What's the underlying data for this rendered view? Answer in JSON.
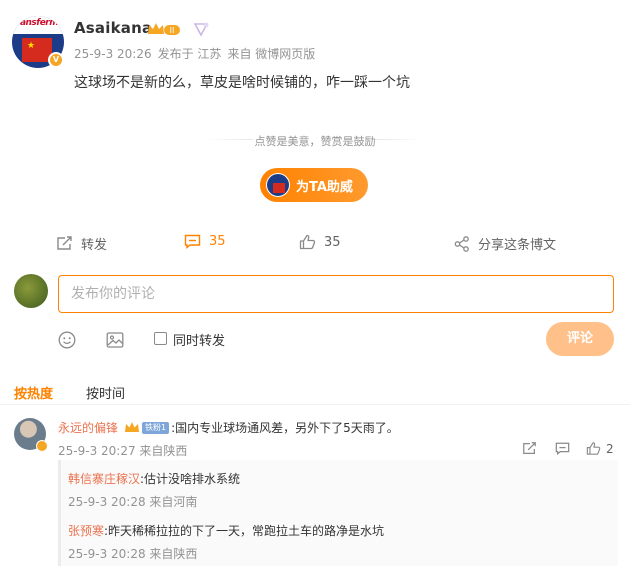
{
  "post": {
    "username": "Asaikana",
    "avatar_text": "ransfermarkt",
    "crown_icon": "crown-level-icon",
    "crown_level": "II",
    "meta": {
      "date": "25-9-3 20:26",
      "posted_from": "发布于 江苏",
      "source": "来自 微博网页版"
    },
    "text": "这球场不是新的么，草皮是啥时候铺的，咋一踩一个坑"
  },
  "reward": {
    "tip_text": "点赞是美意，赞赏是鼓励",
    "support_label": "为TA助威"
  },
  "actions": {
    "repost_label": "转发",
    "comment_count": "35",
    "like_count": "35",
    "share_label": "分享这条博文"
  },
  "composer": {
    "placeholder": "发布你的评论",
    "repost_checkbox_label": "同时转发",
    "submit_label": "评论"
  },
  "sort": {
    "hot_label": "按热度",
    "time_label": "按时间"
  },
  "comments": [
    {
      "name": "永远的偏锋",
      "level_badge": "铁粉1",
      "text": ":国内专业球场通风差，另外下了5天雨了。",
      "meta": "25-9-3 20:27 来自陕西",
      "like_count": "2",
      "replies": [
        {
          "name": "韩信寨庄稼汉",
          "text": ":估计没啥排水系统",
          "meta": "25-9-3 20:28 来自河南"
        },
        {
          "name": "张预寒",
          "text": ":昨天稀稀拉拉的下了一天，常跑拉土车的路净是水坑",
          "meta": "25-9-3 20:28 来自陕西"
        }
      ]
    }
  ],
  "colors": {
    "accent": "#ff8200",
    "name_link": "#eb7350",
    "meta_gray": "#939393"
  }
}
